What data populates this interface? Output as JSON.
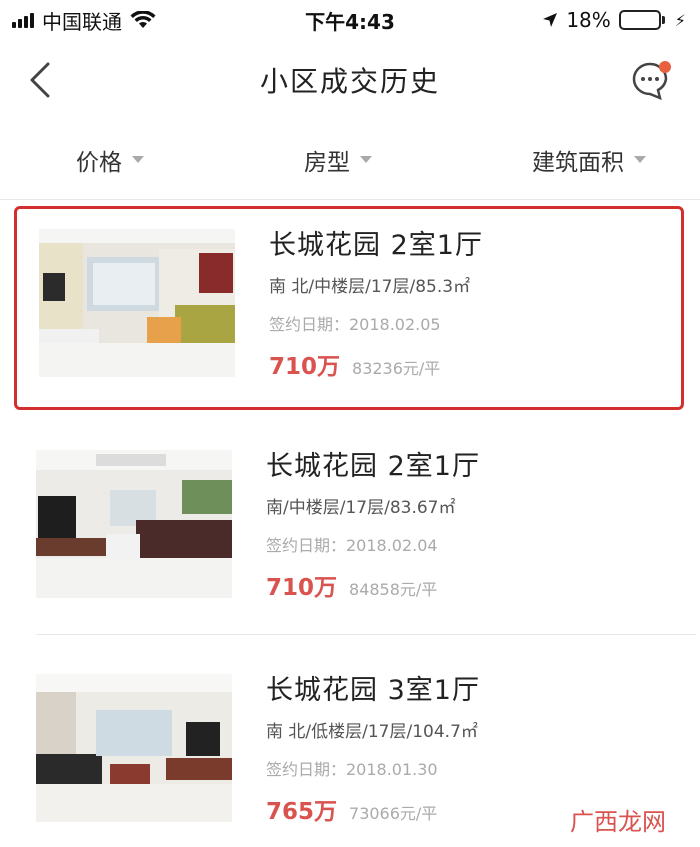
{
  "status": {
    "carrier": "中国联通",
    "time": "下午4:43",
    "battery": "18%"
  },
  "nav": {
    "title": "小区成交历史"
  },
  "filters": [
    {
      "label": "价格"
    },
    {
      "label": "房型"
    },
    {
      "label": "建筑面积"
    }
  ],
  "listings": [
    {
      "title": "长城花园 2室1厅",
      "meta": "南 北/中楼层/17层/85.3㎡",
      "date": "签约日期：2018.02.05",
      "price": "710万",
      "unit_price": "83236元/平"
    },
    {
      "title": "长城花园 2室1厅",
      "meta": "南/中楼层/17层/83.67㎡",
      "date": "签约日期：2018.02.04",
      "price": "710万",
      "unit_price": "84858元/平"
    },
    {
      "title": "长城花园 3室1厅",
      "meta": "南 北/低楼层/17层/104.7㎡",
      "date": "签约日期：2018.01.30",
      "price": "765万",
      "unit_price": "73066元/平"
    }
  ],
  "watermark": "广西龙网",
  "colors": {
    "accent": "#d9534f",
    "highlight_border": "#d32f2f",
    "battery": "#e8c400"
  }
}
